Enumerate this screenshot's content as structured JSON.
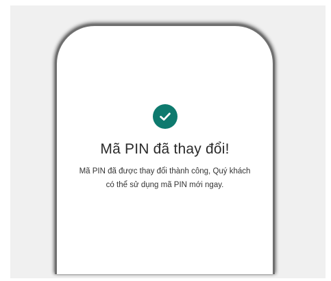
{
  "dialog": {
    "title": "Mã PIN đã thay đổi!",
    "message_line1": "Mã PIN đã được thay đổi thành công, Quý khách",
    "message_line2": "có thể sử dụng mã PIN mới ngay.",
    "icon": "check-circle-icon",
    "accent_color": "#0e7a6e"
  }
}
